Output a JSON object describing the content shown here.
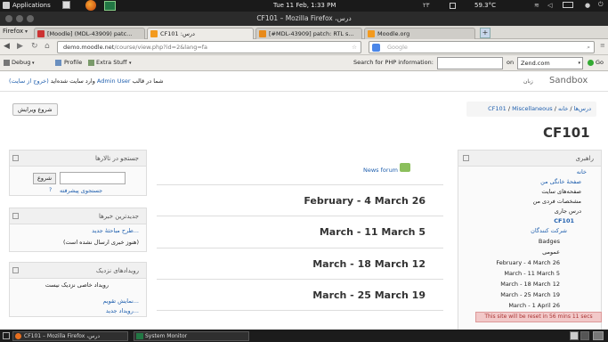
{
  "system_bar": {
    "applications": "Applications",
    "clock": "Tue 11 Feb,  1:33 PM",
    "lang": "۲۳",
    "temperature": "59.3°C"
  },
  "window": {
    "title": "CF101 – Mozilla Firefox ،درس"
  },
  "tabs": [
    {
      "label": "[Moodle] (MDL-43909) patc..."
    },
    {
      "label": "CF101 :درس"
    },
    {
      "label": "[#MDL-43909] patch: RTL s..."
    },
    {
      "label": "Moodle.org"
    }
  ],
  "firefox_menu": "Firefox",
  "url": {
    "host": "demo.moodle.net",
    "path": "/course/view.php?id=2&lang=fa"
  },
  "search": {
    "engine": "Google",
    "placeholder": "Google"
  },
  "bookmarks": {
    "debug": "Debug",
    "profile": "Profile",
    "extra": "Extra Stuff",
    "php_label": "Search for PHP information:",
    "on": "on",
    "zend": "Zend.com",
    "go": "Go"
  },
  "moodle": {
    "sandbox": "Sandbox",
    "language": "زبان",
    "login_info": "شما در قالب",
    "user": "Admin User",
    "login_suffix": "وارد سایت شده‌اید",
    "logout": "(خروج از سایت)",
    "edit_button": "شروع ویرایش",
    "breadcrumb": [
      "خانه",
      "درس‌ها",
      "Miscellaneous",
      "CF101"
    ],
    "course_title": "CF101",
    "forum_search": {
      "title": "جستجو در تالارها",
      "button": "شروع",
      "advanced": "جستجوی پیشرفته"
    },
    "latest_news": {
      "title": "جدیدترین خبرها",
      "add": "طرح مباحثهٔ جدید...",
      "empty": "(هنوز خبری ارسال نشده است)"
    },
    "upcoming": {
      "title": "رویدادهای نزدیک",
      "empty": "رویداد خاصی نزدیک نیست",
      "calendar": "نمایش تقویم...",
      "new_event": "رویداد جدید..."
    },
    "news_forum": "News forum",
    "weeks": [
      "February - 4 March 26",
      "March - 11 March 5",
      "March - 18 March 12",
      "March - 25 March 19"
    ],
    "navigation": {
      "title": "راهبری",
      "items": [
        "خانه",
        "صفحهٔ خانگی من",
        "صفحه‌های سایت",
        "مشخصات فردی من",
        "درس جاری",
        "CF101",
        "شرکت کنندگان",
        "Badges",
        "عمومی",
        "February - 4 March 26",
        "March - 11 March 5",
        "March - 18 March 12",
        "March - 25 March 19",
        "March - 1 April 26"
      ]
    },
    "reset_notice": "This site will be reset in 56 mins 11 secs"
  },
  "taskbar": {
    "firefox": "CF101 – Mozilla Firefox ،درس",
    "monitor": "System Monitor"
  }
}
